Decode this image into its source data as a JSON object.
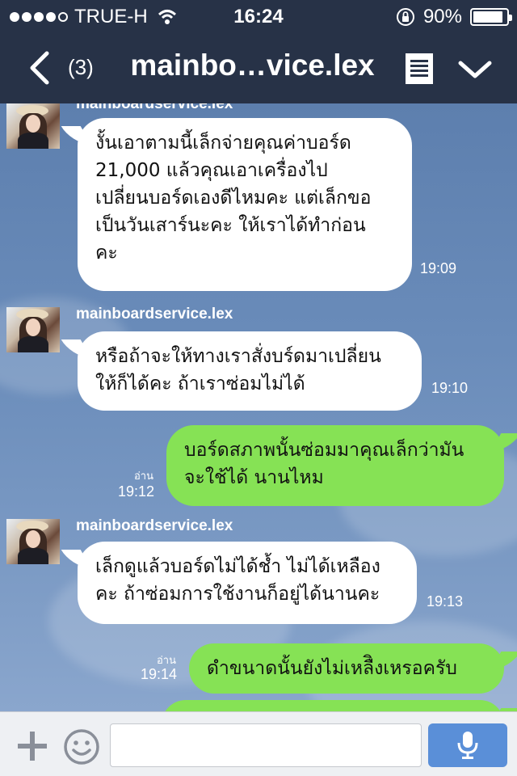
{
  "status_bar": {
    "carrier": "TRUE-H",
    "time": "16:24",
    "battery": "90%",
    "battery_level": 0.9,
    "signal_bars_filled": 4,
    "signal_bars_total": 5,
    "icons": [
      "wifi-icon",
      "orientation-lock-icon",
      "battery-icon"
    ]
  },
  "nav": {
    "back_icon": "chevron-left-icon",
    "unread_count": "(3)",
    "title": "mainbo…vice.lex",
    "note_icon": "note-icon",
    "menu_icon": "chevron-down-icon"
  },
  "chat": {
    "messages": [
      {
        "direction": "in",
        "sender": "mainboardservice.lex",
        "lines": [
          "งั้นเอาตามนี้เล็กจ่ายคุณค่าบอร์ด",
          "21,000  แล้วคุณเอาเครื่องไป",
          "เปลี่ยนบอร์ดเองดีไหมคะ แต่เล็กขอ",
          "เป็นวันเสาร์นะคะ ให้เราได้ทำก่อน",
          "คะ"
        ],
        "time": "19:09"
      },
      {
        "direction": "in",
        "sender": "mainboardservice.lex",
        "lines": [
          "หรือถ้าจะให้ทางเราสั่งบร์ดมาเปลี่ยน",
          "ให้ก็ได้คะ ถ้าเราซ่อมไม่ได้"
        ],
        "time": "19:10"
      },
      {
        "direction": "out",
        "read": "อ่าน",
        "lines": [
          "บอร์ดสภาพนั้นซ่อมมาคุณเล็กว่ามัน",
          "จะใช้ได้ นานไหม"
        ],
        "time": "19:12"
      },
      {
        "direction": "in",
        "sender": "mainboardservice.lex",
        "lines": [
          "เล็กดูแล้วบอร์ดไม่ได้ช้ำ ไม่ได้เหลือง",
          "คะ ถ้าซ่อมการใช้งานก็อยู่ได้นานคะ"
        ],
        "time": "19:13"
      },
      {
        "direction": "out",
        "read": "อ่าน",
        "lines": [
          "ดำขนาดนั้นยังไม่เหลืิงเหรอครับ"
        ],
        "time": "19:14"
      }
    ],
    "colors": {
      "incoming_bubble": "#ffffff",
      "outgoing_bubble": "#86e255",
      "header": "#273247"
    }
  },
  "input_bar": {
    "plus_icon": "plus-icon",
    "emoji_icon": "emoji-icon",
    "placeholder": "",
    "value": "",
    "mic_icon": "microphone-icon"
  }
}
